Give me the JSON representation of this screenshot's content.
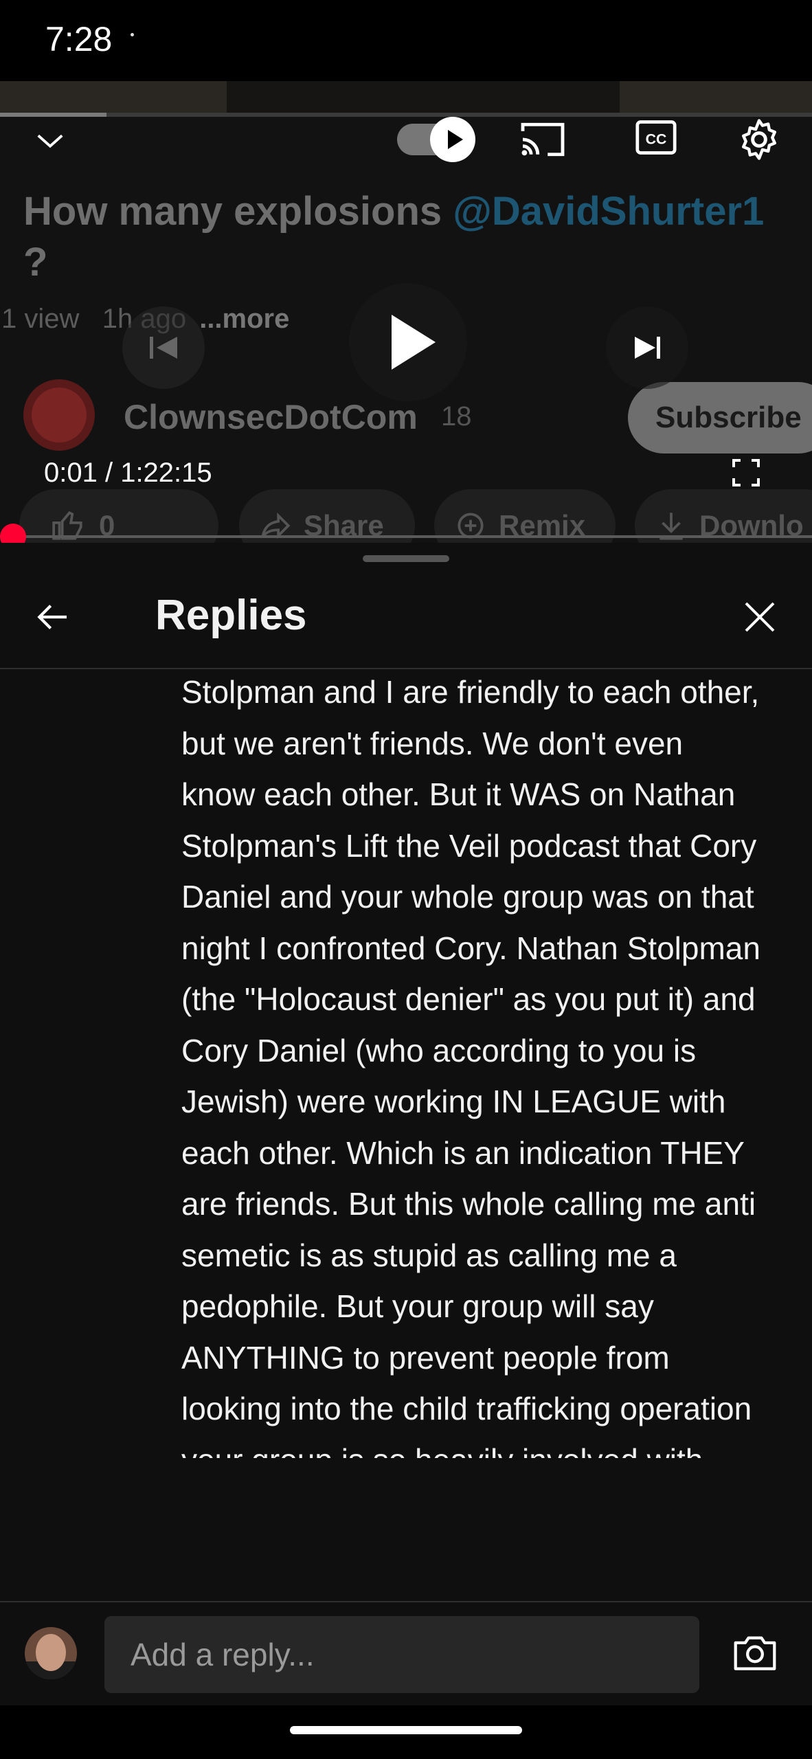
{
  "status_bar": {
    "time": "7:28"
  },
  "video": {
    "title_part1": "How many explosions ",
    "title_mention": "@DavidShurter1",
    "title_part2": "?",
    "views": "1 view",
    "age": "1h ago",
    "more": "...more",
    "channel_name": "ClownsecDotCom",
    "subscriber_count": "18",
    "subscribe_label": "Subscribe",
    "like_count": "0",
    "share_label": "Share",
    "remix_label": "Remix",
    "download_label": "Downlo"
  },
  "player": {
    "time_display": "0:01 / 1:22:15",
    "progress_fraction": 0.0002,
    "autoplay": true
  },
  "sheet": {
    "title": "Replies",
    "reply_text": "Stolpman and I are friendly to each other, but we aren't friends. We don't even know each other. But it WAS on Nathan Stolpman's Lift the Veil podcast that Cory Daniel and your whole group was on that night I confronted Cory. Nathan Stolpman (the \"Holocaust denier\" as you put it) and Cory Daniel (who according to you is Jewish) were working IN LEAGUE with each other. Which is an indication THEY are friends. But this whole calling me anti semetic is as stupid as calling me a pedophile. But your group will say ANYTHING to prevent people from looking into the child trafficking operation your group is so heavily involved with."
  },
  "composer": {
    "placeholder": "Add a reply..."
  },
  "colors": {
    "background": "#0f0f0f",
    "accent_red": "#ff0033",
    "mention_blue": "#3ea6ff"
  }
}
